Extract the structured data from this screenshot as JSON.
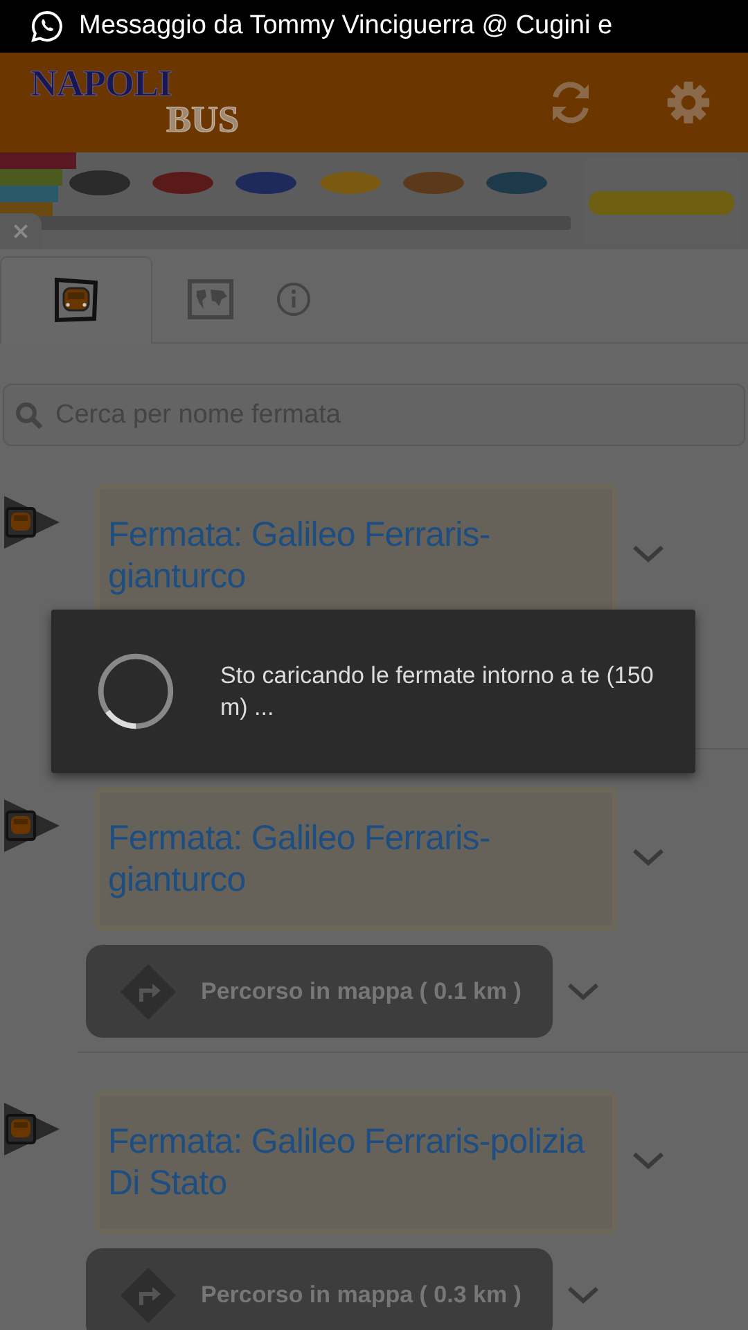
{
  "status_bar": {
    "notification": "Messaggio da Tommy Vinciguerra @ Cugini e"
  },
  "header": {
    "logo_top": "NAPOLI",
    "logo_bottom": "BUS"
  },
  "tabs": [
    {
      "kind": "bus",
      "selected": true
    },
    {
      "kind": "map",
      "selected": false
    },
    {
      "kind": "info",
      "selected": false
    }
  ],
  "search": {
    "placeholder": "Cerca per nome fermata"
  },
  "stops": [
    {
      "title": "Fermata: Galileo Ferraris-gianturco"
    },
    {
      "title": "Fermata: Galileo Ferraris-gianturco",
      "route": "Percorso in mappa ( 0.1 km )"
    },
    {
      "title": "Fermata: Galileo Ferraris-polizia Di Stato",
      "route": "Percorso in mappa ( 0.3 km )"
    }
  ],
  "dialog": {
    "message": "Sto caricando le fermate intorno a te (150 m) ..."
  }
}
